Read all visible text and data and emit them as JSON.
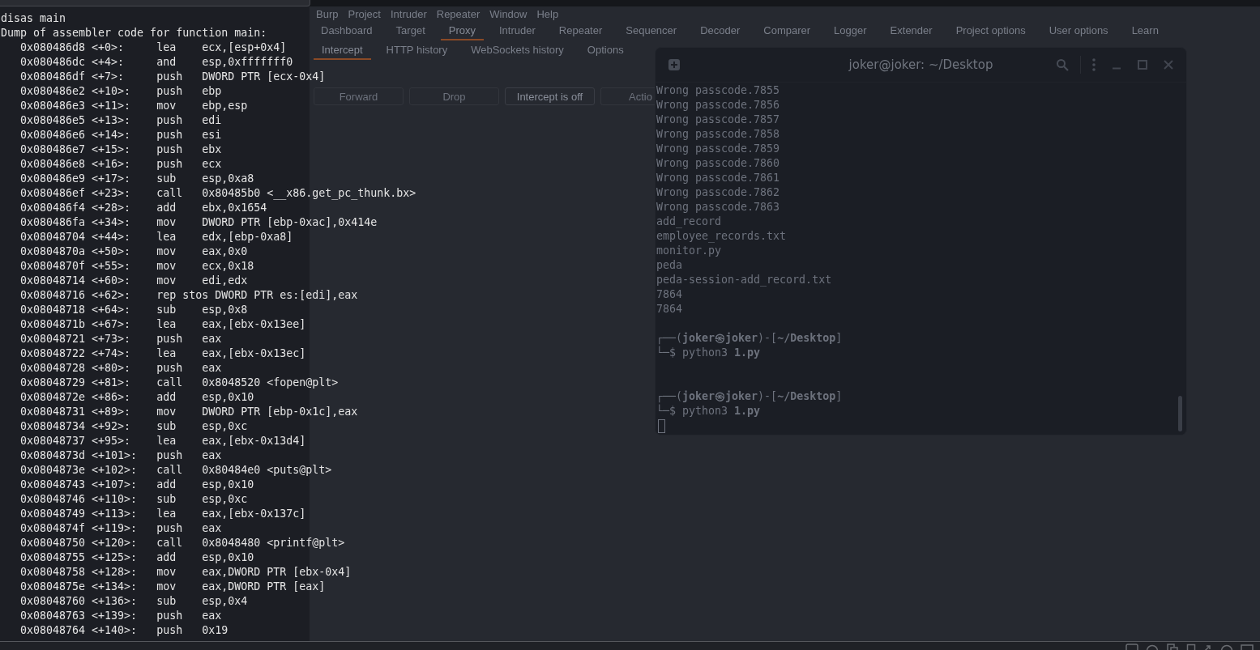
{
  "burp": {
    "menu": [
      "Burp",
      "Project",
      "Intruder",
      "Repeater",
      "Window",
      "Help"
    ],
    "tabs": [
      {
        "label": "Dashboard",
        "selected": false
      },
      {
        "label": "Target",
        "selected": false
      },
      {
        "label": "Proxy",
        "selected": true
      },
      {
        "label": "Intruder",
        "selected": false
      },
      {
        "label": "Repeater",
        "selected": false
      },
      {
        "label": "Sequencer",
        "selected": false
      },
      {
        "label": "Decoder",
        "selected": false
      },
      {
        "label": "Comparer",
        "selected": false
      },
      {
        "label": "Logger",
        "selected": false
      },
      {
        "label": "Extender",
        "selected": false
      },
      {
        "label": "Project options",
        "selected": false
      },
      {
        "label": "User options",
        "selected": false
      },
      {
        "label": "Learn",
        "selected": false
      }
    ],
    "subtabs": [
      {
        "label": "Intercept",
        "selected": true
      },
      {
        "label": "HTTP history",
        "selected": false
      },
      {
        "label": "WebSockets history",
        "selected": false
      },
      {
        "label": "Options",
        "selected": false
      }
    ],
    "buttons": [
      {
        "label": "Forward",
        "disabled": true
      },
      {
        "label": "Drop",
        "disabled": true
      },
      {
        "label": "Intercept is off",
        "disabled": false
      },
      {
        "label": "Actio",
        "disabled": true
      }
    ]
  },
  "left_terminal": {
    "lines": [
      "disas main",
      "Dump of assembler code for function main:",
      "   0x080486d8 <+0>:\tlea    ecx,[esp+0x4]",
      "   0x080486dc <+4>:\tand    esp,0xfffffff0",
      "   0x080486df <+7>:\tpush   DWORD PTR [ecx-0x4]",
      "   0x080486e2 <+10>:\tpush   ebp",
      "   0x080486e3 <+11>:\tmov    ebp,esp",
      "   0x080486e5 <+13>:\tpush   edi",
      "   0x080486e6 <+14>:\tpush   esi",
      "   0x080486e7 <+15>:\tpush   ebx",
      "   0x080486e8 <+16>:\tpush   ecx",
      "   0x080486e9 <+17>:\tsub    esp,0xa8",
      "   0x080486ef <+23>:\tcall   0x80485b0 <__x86.get_pc_thunk.bx>",
      "   0x080486f4 <+28>:\tadd    ebx,0x1654",
      "   0x080486fa <+34>:\tmov    DWORD PTR [ebp-0xac],0x414e",
      "   0x08048704 <+44>:\tlea    edx,[ebp-0xa8]",
      "   0x0804870a <+50>:\tmov    eax,0x0",
      "   0x0804870f <+55>:\tmov    ecx,0x18",
      "   0x08048714 <+60>:\tmov    edi,edx",
      "   0x08048716 <+62>:\trep stos DWORD PTR es:[edi],eax",
      "   0x08048718 <+64>:\tsub    esp,0x8",
      "   0x0804871b <+67>:\tlea    eax,[ebx-0x13ee]",
      "   0x08048721 <+73>:\tpush   eax",
      "   0x08048722 <+74>:\tlea    eax,[ebx-0x13ec]",
      "   0x08048728 <+80>:\tpush   eax",
      "   0x08048729 <+81>:\tcall   0x8048520 <fopen@plt>",
      "   0x0804872e <+86>:\tadd    esp,0x10",
      "   0x08048731 <+89>:\tmov    DWORD PTR [ebp-0x1c],eax",
      "   0x08048734 <+92>:\tsub    esp,0xc",
      "   0x08048737 <+95>:\tlea    eax,[ebx-0x13d4]",
      "   0x0804873d <+101>:\tpush   eax",
      "   0x0804873e <+102>:\tcall   0x80484e0 <puts@plt>",
      "   0x08048743 <+107>:\tadd    esp,0x10",
      "   0x08048746 <+110>:\tsub    esp,0xc",
      "   0x08048749 <+113>:\tlea    eax,[ebx-0x137c]",
      "   0x0804874f <+119>:\tpush   eax",
      "   0x08048750 <+120>:\tcall   0x8048480 <printf@plt>",
      "   0x08048755 <+125>:\tadd    esp,0x10",
      "   0x08048758 <+128>:\tmov    eax,DWORD PTR [ebx-0x4]",
      "   0x0804875e <+134>:\tmov    eax,DWORD PTR [eax]",
      "   0x08048760 <+136>:\tsub    esp,0x4",
      "   0x08048763 <+139>:\tpush   eax",
      "   0x08048764 <+140>:\tpush   0x19"
    ]
  },
  "right_terminal": {
    "title": "joker@joker: ~/Desktop",
    "lines": [
      {
        "kind": "output",
        "text": "Wrong passcode.7855"
      },
      {
        "kind": "output",
        "text": "Wrong passcode.7856"
      },
      {
        "kind": "output",
        "text": "Wrong passcode.7857"
      },
      {
        "kind": "output",
        "text": "Wrong passcode.7858"
      },
      {
        "kind": "output",
        "text": "Wrong passcode.7859"
      },
      {
        "kind": "output",
        "text": "Wrong passcode.7860"
      },
      {
        "kind": "output",
        "text": "Wrong passcode.7861"
      },
      {
        "kind": "output",
        "text": "Wrong passcode.7862"
      },
      {
        "kind": "output",
        "text": "Wrong passcode.7863"
      },
      {
        "kind": "output",
        "text": "add_record"
      },
      {
        "kind": "output",
        "text": "employee_records.txt"
      },
      {
        "kind": "output",
        "text": "monitor.py"
      },
      {
        "kind": "output",
        "text": "peda"
      },
      {
        "kind": "output",
        "text": "peda-session-add_record.txt"
      },
      {
        "kind": "output",
        "text": "7864"
      },
      {
        "kind": "output",
        "text": "7864"
      },
      {
        "kind": "blank"
      },
      {
        "kind": "prompt",
        "text": "┌──(**joker㉿joker**)-[**~/Desktop**]"
      },
      {
        "kind": "command",
        "text": "└─$ python3 **1.py**"
      },
      {
        "kind": "blank"
      },
      {
        "kind": "blank"
      },
      {
        "kind": "prompt",
        "text": "┌──(**joker㉿joker**)-[**~/Desktop**]"
      },
      {
        "kind": "command",
        "text": "└─$ python3 **1.py**"
      },
      {
        "kind": "cursor"
      }
    ]
  }
}
